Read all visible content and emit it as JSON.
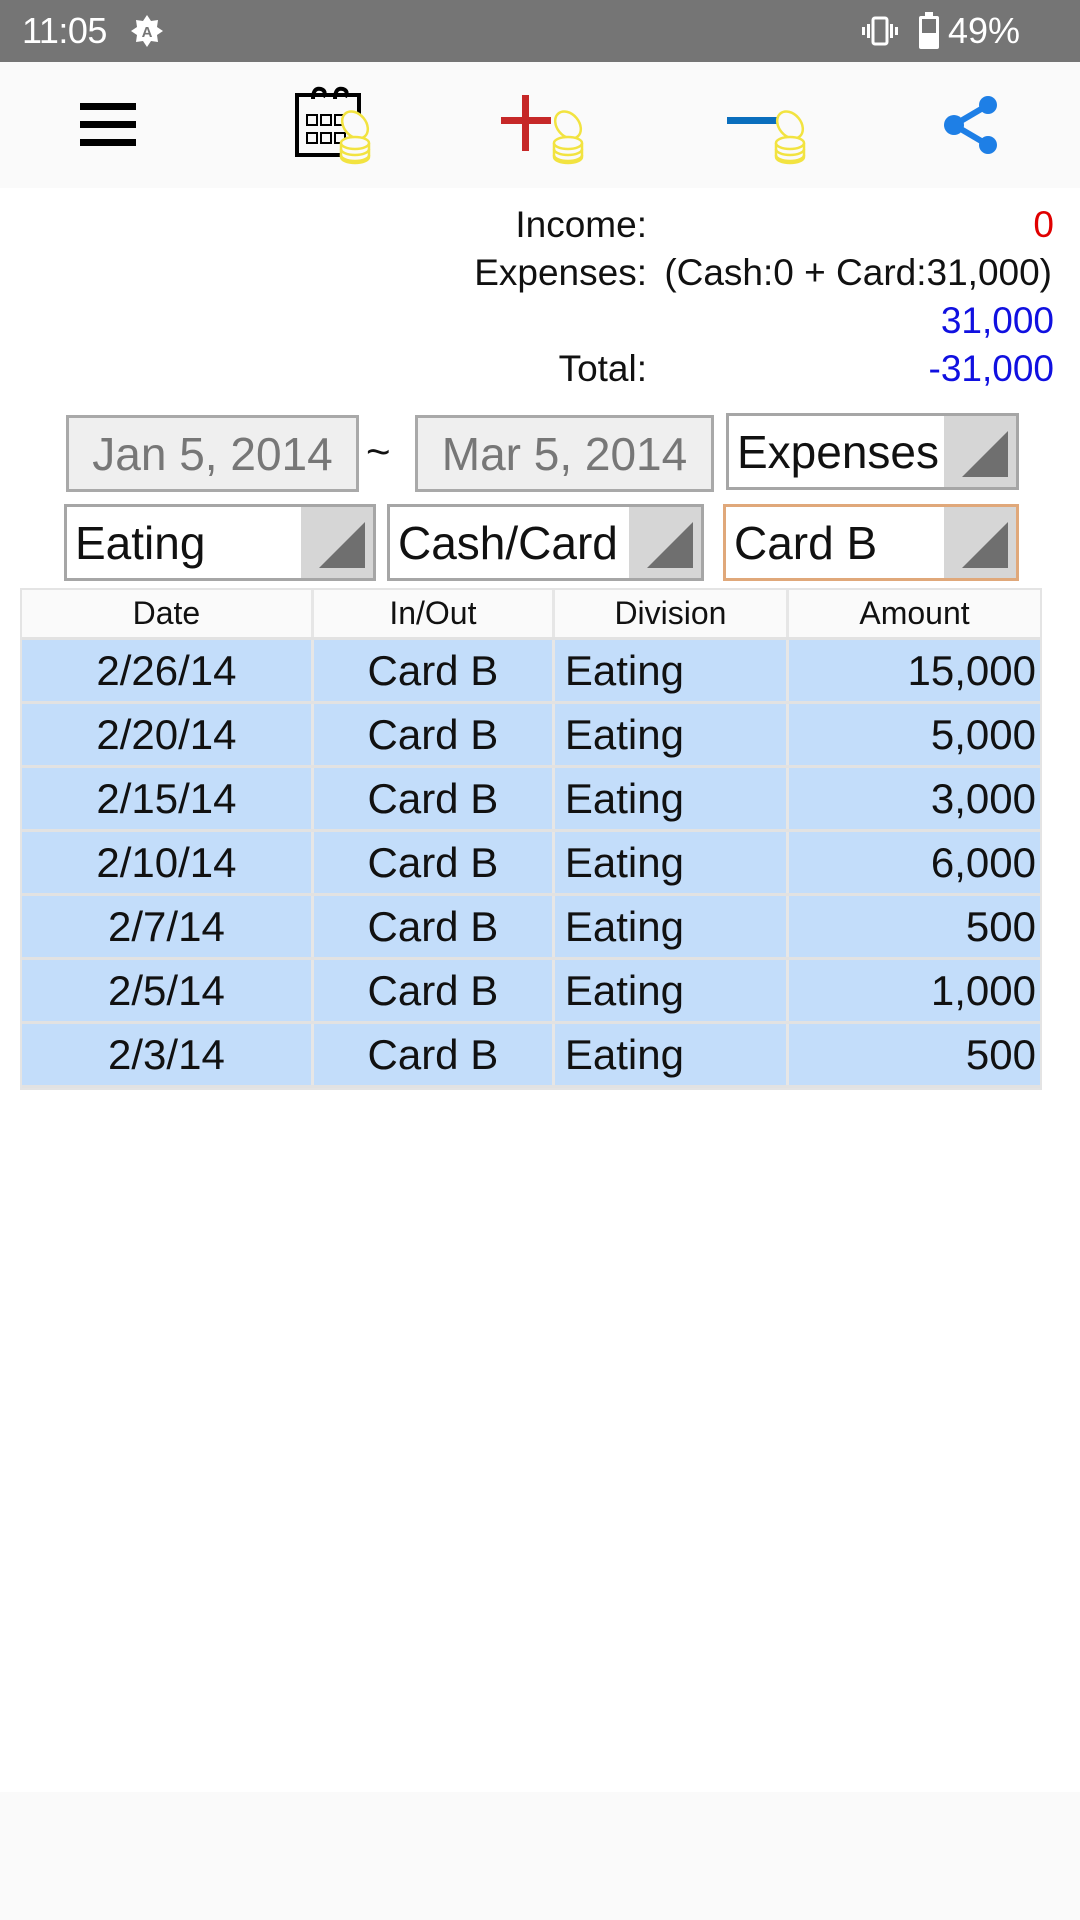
{
  "status_bar": {
    "time": "11:05",
    "auto_brightness_icon": "auto-brightness-icon",
    "vibrate_icon": "vibrate-icon",
    "battery_icon": "battery-icon",
    "battery_percent": "49%"
  },
  "toolbar": {
    "items": [
      {
        "name": "menu",
        "icon": "hamburger-menu-icon"
      },
      {
        "name": "calendar",
        "icon": "calendar-coins-icon"
      },
      {
        "name": "add-income",
        "icon": "plus-coins-icon",
        "color": "#c62828"
      },
      {
        "name": "add-expense",
        "icon": "minus-coins-icon",
        "color": "#0a6ebd"
      },
      {
        "name": "share",
        "icon": "share-icon",
        "color": "#1e7fe6"
      }
    ]
  },
  "summary": {
    "income_label": "Income:",
    "income_value": "0",
    "income_color": "#e00000",
    "expenses_label": "Expenses:",
    "expenses_breakdown": "(Cash:0 + Card:31,000)",
    "expenses_value": "31,000",
    "expenses_color": "#1010e0",
    "total_label": "Total:",
    "total_value": "-31,000",
    "total_color": "#1010e0"
  },
  "filters": {
    "start_date": "Jan 5, 2014",
    "separator": "~",
    "end_date": "Mar 5, 2014",
    "type": "Expenses",
    "division": "Eating",
    "payment_method": "Cash/Card",
    "account": "Card B"
  },
  "table": {
    "columns": [
      "Date",
      "In/Out",
      "Division",
      "Amount"
    ],
    "rows": [
      {
        "date": "2/26/14",
        "inout": "Card B",
        "division": "Eating",
        "amount": "15,000"
      },
      {
        "date": "2/20/14",
        "inout": "Card B",
        "division": "Eating",
        "amount": "5,000"
      },
      {
        "date": "2/15/14",
        "inout": "Card B",
        "division": "Eating",
        "amount": "3,000"
      },
      {
        "date": "2/10/14",
        "inout": "Card B",
        "division": "Eating",
        "amount": "6,000"
      },
      {
        "date": "2/7/14",
        "inout": "Card B",
        "division": "Eating",
        "amount": "500"
      },
      {
        "date": "2/5/14",
        "inout": "Card B",
        "division": "Eating",
        "amount": "1,000"
      },
      {
        "date": "2/3/14",
        "inout": "Card B",
        "division": "Eating",
        "amount": "500"
      }
    ]
  }
}
